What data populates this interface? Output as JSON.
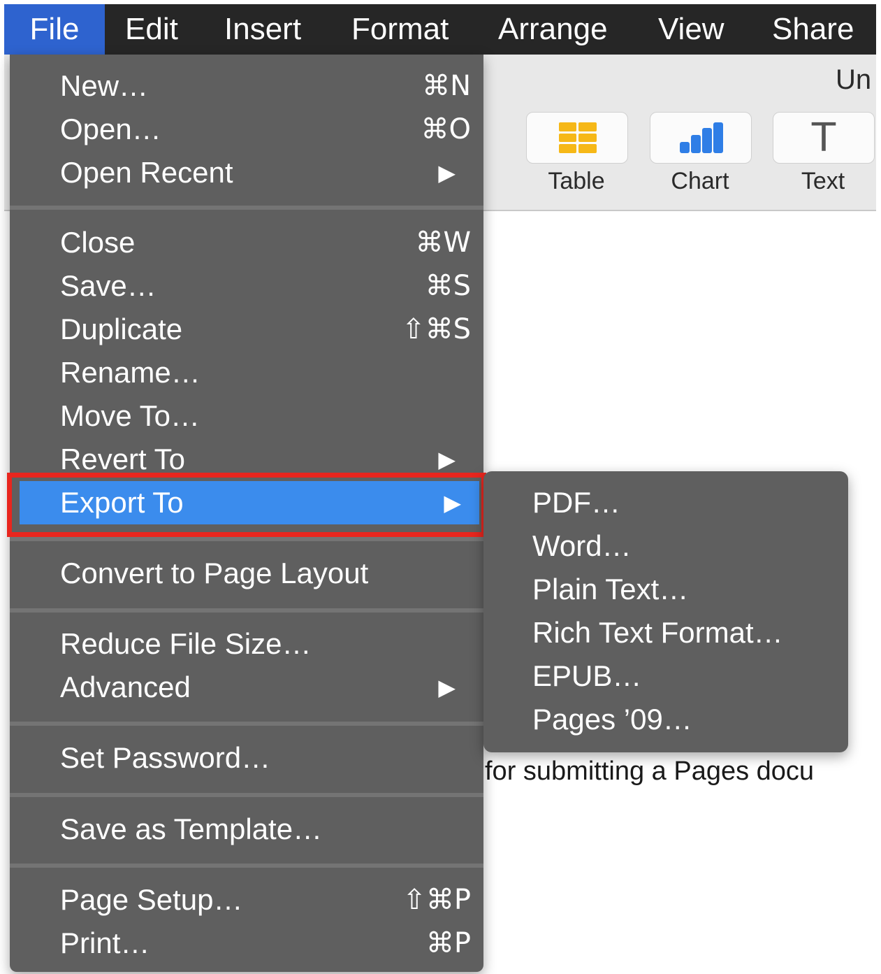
{
  "menubar": {
    "items": [
      "File",
      "Edit",
      "Insert",
      "Format",
      "Arrange",
      "View",
      "Share"
    ],
    "active": "File"
  },
  "window": {
    "title_fragment": "Un",
    "toolbar": {
      "table_label": "Table",
      "chart_label": "Chart",
      "text_label": "Text",
      "text_icon_glyph": "T"
    },
    "document_fragment": "for submitting a Pages docu"
  },
  "file_menu": {
    "new": {
      "label": "New…",
      "shortcut": "⌘N"
    },
    "open": {
      "label": "Open…",
      "shortcut": "⌘O"
    },
    "open_recent": {
      "label": "Open Recent",
      "submenu": "▶"
    },
    "close": {
      "label": "Close",
      "shortcut": "⌘W"
    },
    "save": {
      "label": "Save…",
      "shortcut": "⌘S"
    },
    "duplicate": {
      "label": "Duplicate",
      "shortcut": "⇧⌘S"
    },
    "rename": {
      "label": "Rename…"
    },
    "move_to": {
      "label": "Move To…"
    },
    "revert_to": {
      "label": "Revert To",
      "submenu": "▶"
    },
    "export_to": {
      "label": "Export To",
      "submenu": "▶"
    },
    "convert": {
      "label": "Convert to Page Layout"
    },
    "reduce": {
      "label": "Reduce File Size…"
    },
    "advanced": {
      "label": "Advanced",
      "submenu": "▶"
    },
    "set_password": {
      "label": "Set Password…"
    },
    "save_template": {
      "label": "Save as Template…"
    },
    "page_setup": {
      "label": "Page Setup…",
      "shortcut": "⇧⌘P"
    },
    "print": {
      "label": "Print…",
      "shortcut": "⌘P"
    }
  },
  "export_submenu": {
    "items": [
      "PDF…",
      "Word…",
      "Plain Text…",
      "Rich Text Format…",
      "EPUB…",
      "Pages ’09…"
    ]
  },
  "colors": {
    "menubar_bg": "#262626",
    "menu_bg": "#5f5f5f",
    "highlight": "#3b8ced",
    "active_menu": "#2e63cf",
    "annotation_red": "#e8261e"
  }
}
